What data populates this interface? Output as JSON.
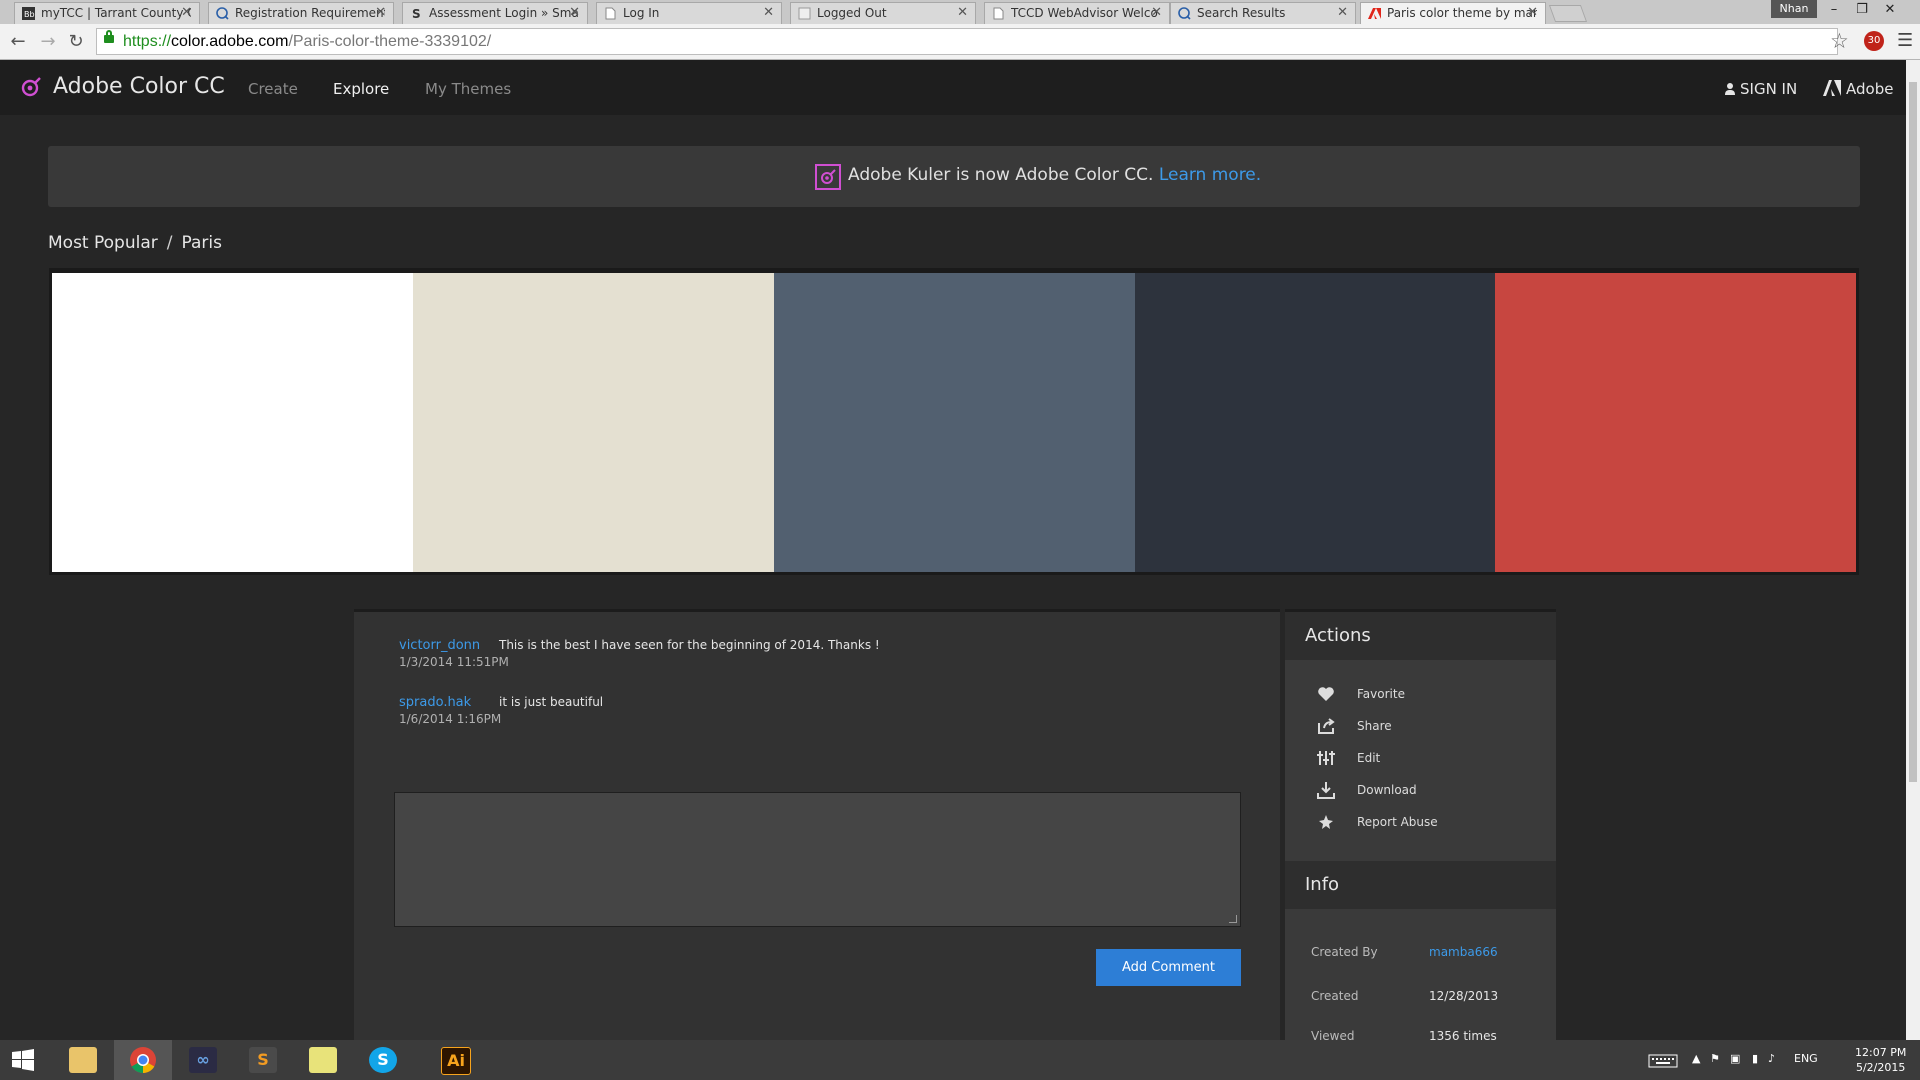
{
  "browser": {
    "tabs": [
      {
        "title": "myTCC | Tarrant County C",
        "icon": "blackboard-icon",
        "active": false
      },
      {
        "title": "Registration Requirement",
        "icon": "globe-search-icon",
        "active": false
      },
      {
        "title": "Assessment Login » Smar",
        "icon": "smarthinking-icon",
        "active": false
      },
      {
        "title": "Log In",
        "icon": "page-icon",
        "active": false
      },
      {
        "title": "Logged Out",
        "icon": "page-icon",
        "active": false
      },
      {
        "title": "TCCD WebAdvisor Welco",
        "icon": "page-icon",
        "active": false
      },
      {
        "title": "Search Results",
        "icon": "globe-search-icon",
        "active": false
      },
      {
        "title": "Paris color theme by mam",
        "icon": "adobe-icon",
        "active": true
      }
    ],
    "profile_name": "Nhan",
    "url": {
      "scheme": "https://",
      "host": "color.adobe.com",
      "path": "/Paris-color-theme-3339102/"
    },
    "extension_badge": "30"
  },
  "site": {
    "brand": "Adobe Color CC",
    "nav": [
      {
        "label": "Create",
        "active": false
      },
      {
        "label": "Explore",
        "active": true
      },
      {
        "label": "My Themes",
        "active": false
      }
    ],
    "sign_in": "SIGN IN",
    "adobe": "Adobe"
  },
  "notice": {
    "text": "Adobe Kuler is now Adobe Color CC.",
    "link": "Learn more."
  },
  "breadcrumb": {
    "parent": "Most Popular",
    "separator": "/",
    "current": "Paris"
  },
  "palette": {
    "colors": [
      "#ffffff",
      "#e4e0d1",
      "#526070",
      "#2d333d",
      "#c74640"
    ]
  },
  "comments": [
    {
      "author": "victorr_donn",
      "time": "1/3/2014 11:51PM",
      "text": "This is the best I have seen for the beginning of 2014. Thanks !"
    },
    {
      "author": "sprado.hak",
      "time": "1/6/2014 1:16PM",
      "text": "it is just beautiful"
    }
  ],
  "comment_input": {
    "value": ""
  },
  "add_comment_label": "Add Comment",
  "actions": {
    "title": "Actions",
    "items": [
      {
        "label": "Favorite",
        "icon": "heart-icon"
      },
      {
        "label": "Share",
        "icon": "share-icon"
      },
      {
        "label": "Edit",
        "icon": "sliders-icon"
      },
      {
        "label": "Download",
        "icon": "download-icon"
      },
      {
        "label": "Report Abuse",
        "icon": "report-icon"
      }
    ]
  },
  "info": {
    "title": "Info",
    "created_by_label": "Created By",
    "created_by": "mamba666",
    "created_label": "Created",
    "created": "12/28/2013",
    "viewed_label": "Viewed",
    "viewed": "1356 times"
  },
  "taskbar": {
    "apps": [
      "File Explorer",
      "Google Chrome",
      "Visual Studio",
      "Sublime Text",
      "Sticky Notes",
      "Skype",
      "Adobe Illustrator"
    ],
    "language": "ENG",
    "time": "12:07 PM",
    "date": "5/2/2015"
  },
  "colors": {
    "accent_blue": "#3d9ae8",
    "button_blue": "#2d7ed6",
    "brand_pink": "#d04fd2"
  }
}
